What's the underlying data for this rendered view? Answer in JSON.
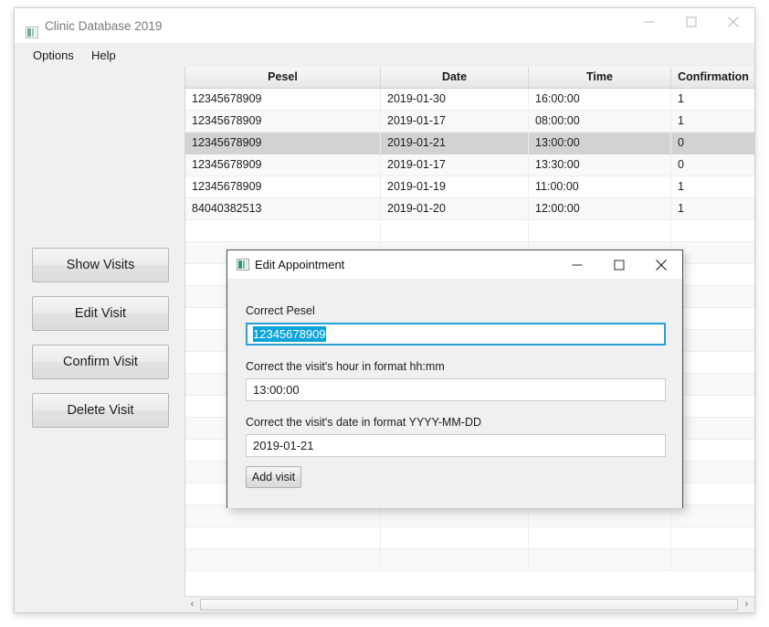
{
  "main_window": {
    "title": "Clinic Database 2019",
    "icon": "app-icon",
    "caption": {
      "minimize": "minimize-icon",
      "maximize": "maximize-icon",
      "close": "close-icon"
    },
    "menu": [
      {
        "label": "Options"
      },
      {
        "label": "Help"
      }
    ],
    "buttons": [
      {
        "label": "Show Visits"
      },
      {
        "label": "Edit Visit"
      },
      {
        "label": "Confirm Visit"
      },
      {
        "label": "Delete Visit"
      }
    ]
  },
  "table": {
    "columns": [
      "Pesel",
      "Date",
      "Time",
      "Confirmation"
    ],
    "rows": [
      {
        "pesel": "12345678909",
        "date": "2019-01-30",
        "time": "16:00:00",
        "confirmation": "1",
        "selected": false
      },
      {
        "pesel": "12345678909",
        "date": "2019-01-17",
        "time": "08:00:00",
        "confirmation": "1",
        "selected": false
      },
      {
        "pesel": "12345678909",
        "date": "2019-01-21",
        "time": "13:00:00",
        "confirmation": "0",
        "selected": true
      },
      {
        "pesel": "12345678909",
        "date": "2019-01-17",
        "time": "13:30:00",
        "confirmation": "0",
        "selected": false
      },
      {
        "pesel": "12345678909",
        "date": "2019-01-19",
        "time": "11:00:00",
        "confirmation": "1",
        "selected": false
      },
      {
        "pesel": "84040382513",
        "date": "2019-01-20",
        "time": "12:00:00",
        "confirmation": "1",
        "selected": false
      }
    ],
    "empty_row_count": 16,
    "scrollbar": {
      "left_arrow": "chevron-left-icon",
      "right_arrow": "chevron-right-icon"
    }
  },
  "dialog": {
    "title": "Edit Appointment",
    "icon": "app-icon",
    "caption": {
      "minimize": "minimize-icon",
      "maximize": "maximize-icon",
      "close": "close-icon"
    },
    "fields": [
      {
        "label": "Correct Pesel",
        "value": "12345678909",
        "selected": true
      },
      {
        "label": "Correct the visit's hour in format hh:mm",
        "value": "13:00:00",
        "selected": false
      },
      {
        "label": "Correct the visit's date in format YYYY-MM-DD",
        "value": "2019-01-21",
        "selected": false
      }
    ],
    "submit_label": "Add visit"
  },
  "colors": {
    "selection_highlight": "#0aa3dc",
    "focus_border": "#26a0da",
    "row_selected": "#d2d2d2",
    "panel_bg": "#f0f0f0"
  }
}
